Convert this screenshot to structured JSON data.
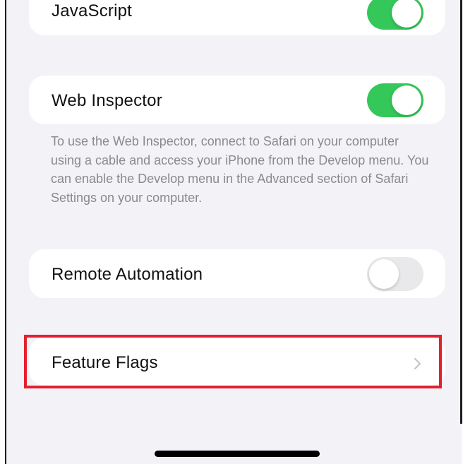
{
  "settings": {
    "javascript": {
      "label": "JavaScript",
      "enabled": true
    },
    "web_inspector": {
      "label": "Web Inspector",
      "enabled": true,
      "footnote": "To use the Web Inspector, connect to Safari on your computer using a cable and access your iPhone from the Develop menu. You can enable the Develop menu in the Advanced section of Safari Settings on your computer."
    },
    "remote_automation": {
      "label": "Remote Automation",
      "enabled": false
    },
    "feature_flags": {
      "label": "Feature Flags"
    }
  },
  "icons": {
    "feature_flags_chevron": "chevron-right-icon"
  },
  "colors": {
    "toggle_on": "#34c759",
    "toggle_off": "#e9e9eb",
    "highlight_box": "#e3202f",
    "background": "#f2f2f7"
  }
}
